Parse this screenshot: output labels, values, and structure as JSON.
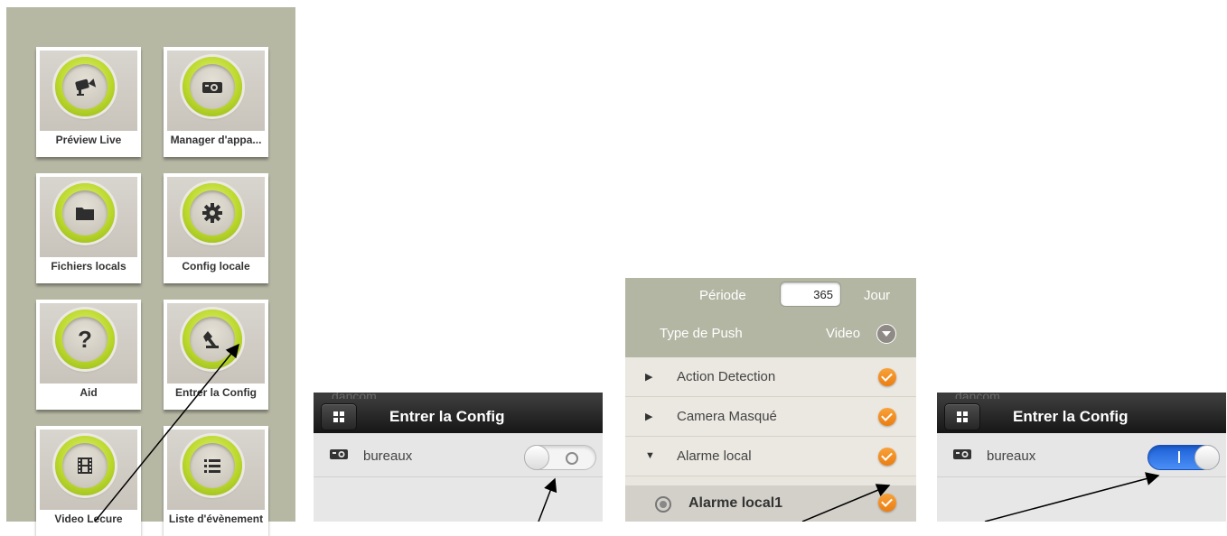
{
  "home": {
    "tiles": [
      {
        "label": "Préview Live",
        "icon": "video-camera-icon"
      },
      {
        "label": "Manager d'appa...",
        "icon": "projector-icon"
      },
      {
        "label": "Fichiers locals",
        "icon": "folder-icon"
      },
      {
        "label": "Config locale",
        "icon": "gear-icon"
      },
      {
        "label": "Aid",
        "icon": "question-icon",
        "glyph": "?"
      },
      {
        "label": "Entrer la Config",
        "icon": "wrench-icon"
      },
      {
        "label": "Video Lecure",
        "icon": "film-icon"
      },
      {
        "label": "Liste d'évènement",
        "icon": "list-icon"
      }
    ]
  },
  "config_off": {
    "ghost_text": "dancom",
    "title": "Entrer la Config",
    "device": "bureaux",
    "toggle": "off"
  },
  "push": {
    "periode_label": "Période",
    "periode_value": "365",
    "periode_unit": "Jour",
    "type_label": "Type de Push",
    "type_value": "Video",
    "items": [
      {
        "label": "Action Detection",
        "arrow": "▶",
        "checked": true
      },
      {
        "label": "Camera Masqué",
        "arrow": "▶",
        "checked": true
      },
      {
        "label": "Alarme local",
        "arrow": "▼",
        "checked": true
      }
    ],
    "subitem": {
      "label": "Alarme local1",
      "checked": true
    }
  },
  "config_on": {
    "ghost_text": "dancom",
    "title": "Entrer la Config",
    "device": "bureaux",
    "toggle": "on"
  },
  "colors": {
    "home_bg": "#b7b8a4",
    "ring_green": "#bcd92c",
    "check_orange": "#ec7d10",
    "toggle_blue": "#1c5fd6"
  }
}
